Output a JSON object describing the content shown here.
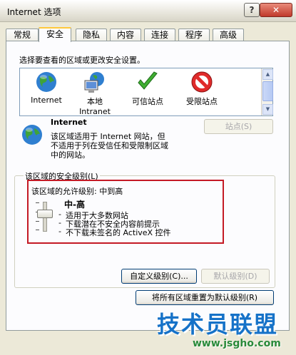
{
  "window": {
    "title": "Internet 选项",
    "help_label": "?",
    "close_label": "✕"
  },
  "tabs": [
    {
      "label": "常规"
    },
    {
      "label": "安全"
    },
    {
      "label": "隐私"
    },
    {
      "label": "内容"
    },
    {
      "label": "连接"
    },
    {
      "label": "程序"
    },
    {
      "label": "高级"
    }
  ],
  "active_tab": "安全",
  "zones_prompt": "选择要查看的区域或更改安全设置。",
  "zones": [
    {
      "label": "Internet",
      "icon": "globe-icon"
    },
    {
      "label": "本地\nIntranet",
      "label_line1": "本地",
      "label_line2": "Intranet",
      "icon": "network-computer-icon"
    },
    {
      "label": "可信站点",
      "icon": "checkmark-icon"
    },
    {
      "label": "受限站点",
      "icon": "no-entry-icon"
    }
  ],
  "selected_zone": {
    "name": "Internet",
    "desc_line1": "该区域适用于 Internet 网站，但",
    "desc_line2": "不适用于列在受信任和受限制区域",
    "desc_line3": "中的网站。",
    "sites_button": "站点(S)"
  },
  "security_level": {
    "group_title": "该区域的安全级别(L)",
    "allowed_label": "该区域的允许级别: 中到高",
    "level_name": "中-高",
    "bullets": [
      "适用于大多数网站",
      "下载潜在不安全内容前提示",
      "不下载未签名的 ActiveX 控件"
    ],
    "slider_level": 0.5,
    "custom_button": "自定义级别(C)...",
    "default_button": "默认级别(D)"
  },
  "reset_all_button": "将所有区域重置为默认级别(R)",
  "watermark": {
    "title": "技术员联盟",
    "url": "www.jsgho.com"
  },
  "colors": {
    "highlight": "#c41a25",
    "tab_accent": "#ffc83c",
    "watermark_blue": "#1672c8"
  }
}
